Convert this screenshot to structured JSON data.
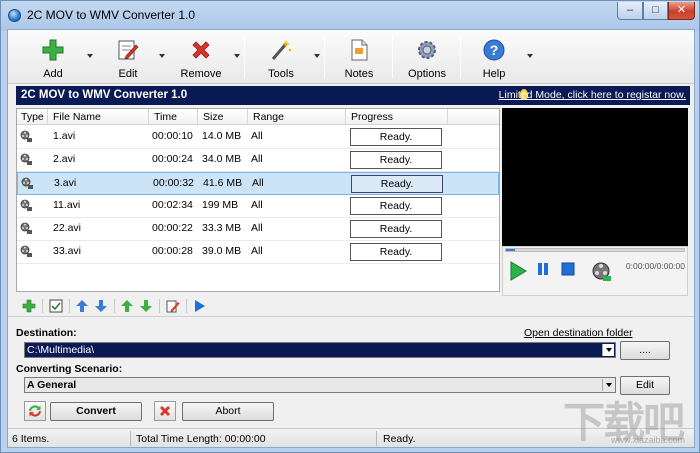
{
  "window": {
    "title": "2C MOV to WMV Converter 1.0",
    "controls": {
      "minimize": "–",
      "maximize": "□",
      "close": "✕"
    }
  },
  "toolbar": {
    "add": "Add",
    "edit": "Edit",
    "remove": "Remove",
    "tools": "Tools",
    "notes": "Notes",
    "options": "Options",
    "help": "Help"
  },
  "banner": {
    "title": "2C MOV to WMV Converter 1.0",
    "register_link": "Limited Mode, click here to registar now."
  },
  "file_list": {
    "columns": [
      "Type",
      "File Name",
      "Time",
      "Size",
      "Range",
      "Progress"
    ],
    "rows": [
      {
        "name": "1.avi",
        "time": "00:00:10",
        "size": "14.0 MB",
        "range": "All",
        "progress": "Ready."
      },
      {
        "name": "2.avi",
        "time": "00:00:24",
        "size": "34.0 MB",
        "range": "All",
        "progress": "Ready."
      },
      {
        "name": "3.avi",
        "time": "00:00:32",
        "size": "41.6 MB",
        "range": "All",
        "progress": "Ready."
      },
      {
        "name": "11.avi",
        "time": "00:02:34",
        "size": "199 MB",
        "range": "All",
        "progress": "Ready."
      },
      {
        "name": "22.avi",
        "time": "00:00:22",
        "size": "33.3 MB",
        "range": "All",
        "progress": "Ready."
      },
      {
        "name": "33.avi",
        "time": "00:00:28",
        "size": "39.0 MB",
        "range": "All",
        "progress": "Ready."
      }
    ],
    "selected_index": 2
  },
  "player": {
    "time": "0:00:00/0:00:00",
    "seek_fraction": 0.05
  },
  "destination": {
    "label": "Destination:",
    "open_folder_link": "Open destination folder",
    "path": "C:\\Multimedia\\",
    "browse_label": "...."
  },
  "scenario": {
    "label": "Converting Scenario:",
    "value": "A General",
    "edit_label": "Edit"
  },
  "actions": {
    "convert": "Convert",
    "abort": "Abort"
  },
  "status": {
    "items": "6 Items.",
    "total_time": "Total Time Length: 00:00:00",
    "state": "Ready."
  },
  "watermark": {
    "text": "下载吧",
    "url": "www.xiazaiba.com"
  },
  "colors": {
    "banner": "#0a1a55",
    "selection": "#cce4f7",
    "add_green": "#3cb043",
    "remove_red": "#d9352a",
    "player_green": "#2db34a",
    "player_blue": "#1e6fd6"
  }
}
